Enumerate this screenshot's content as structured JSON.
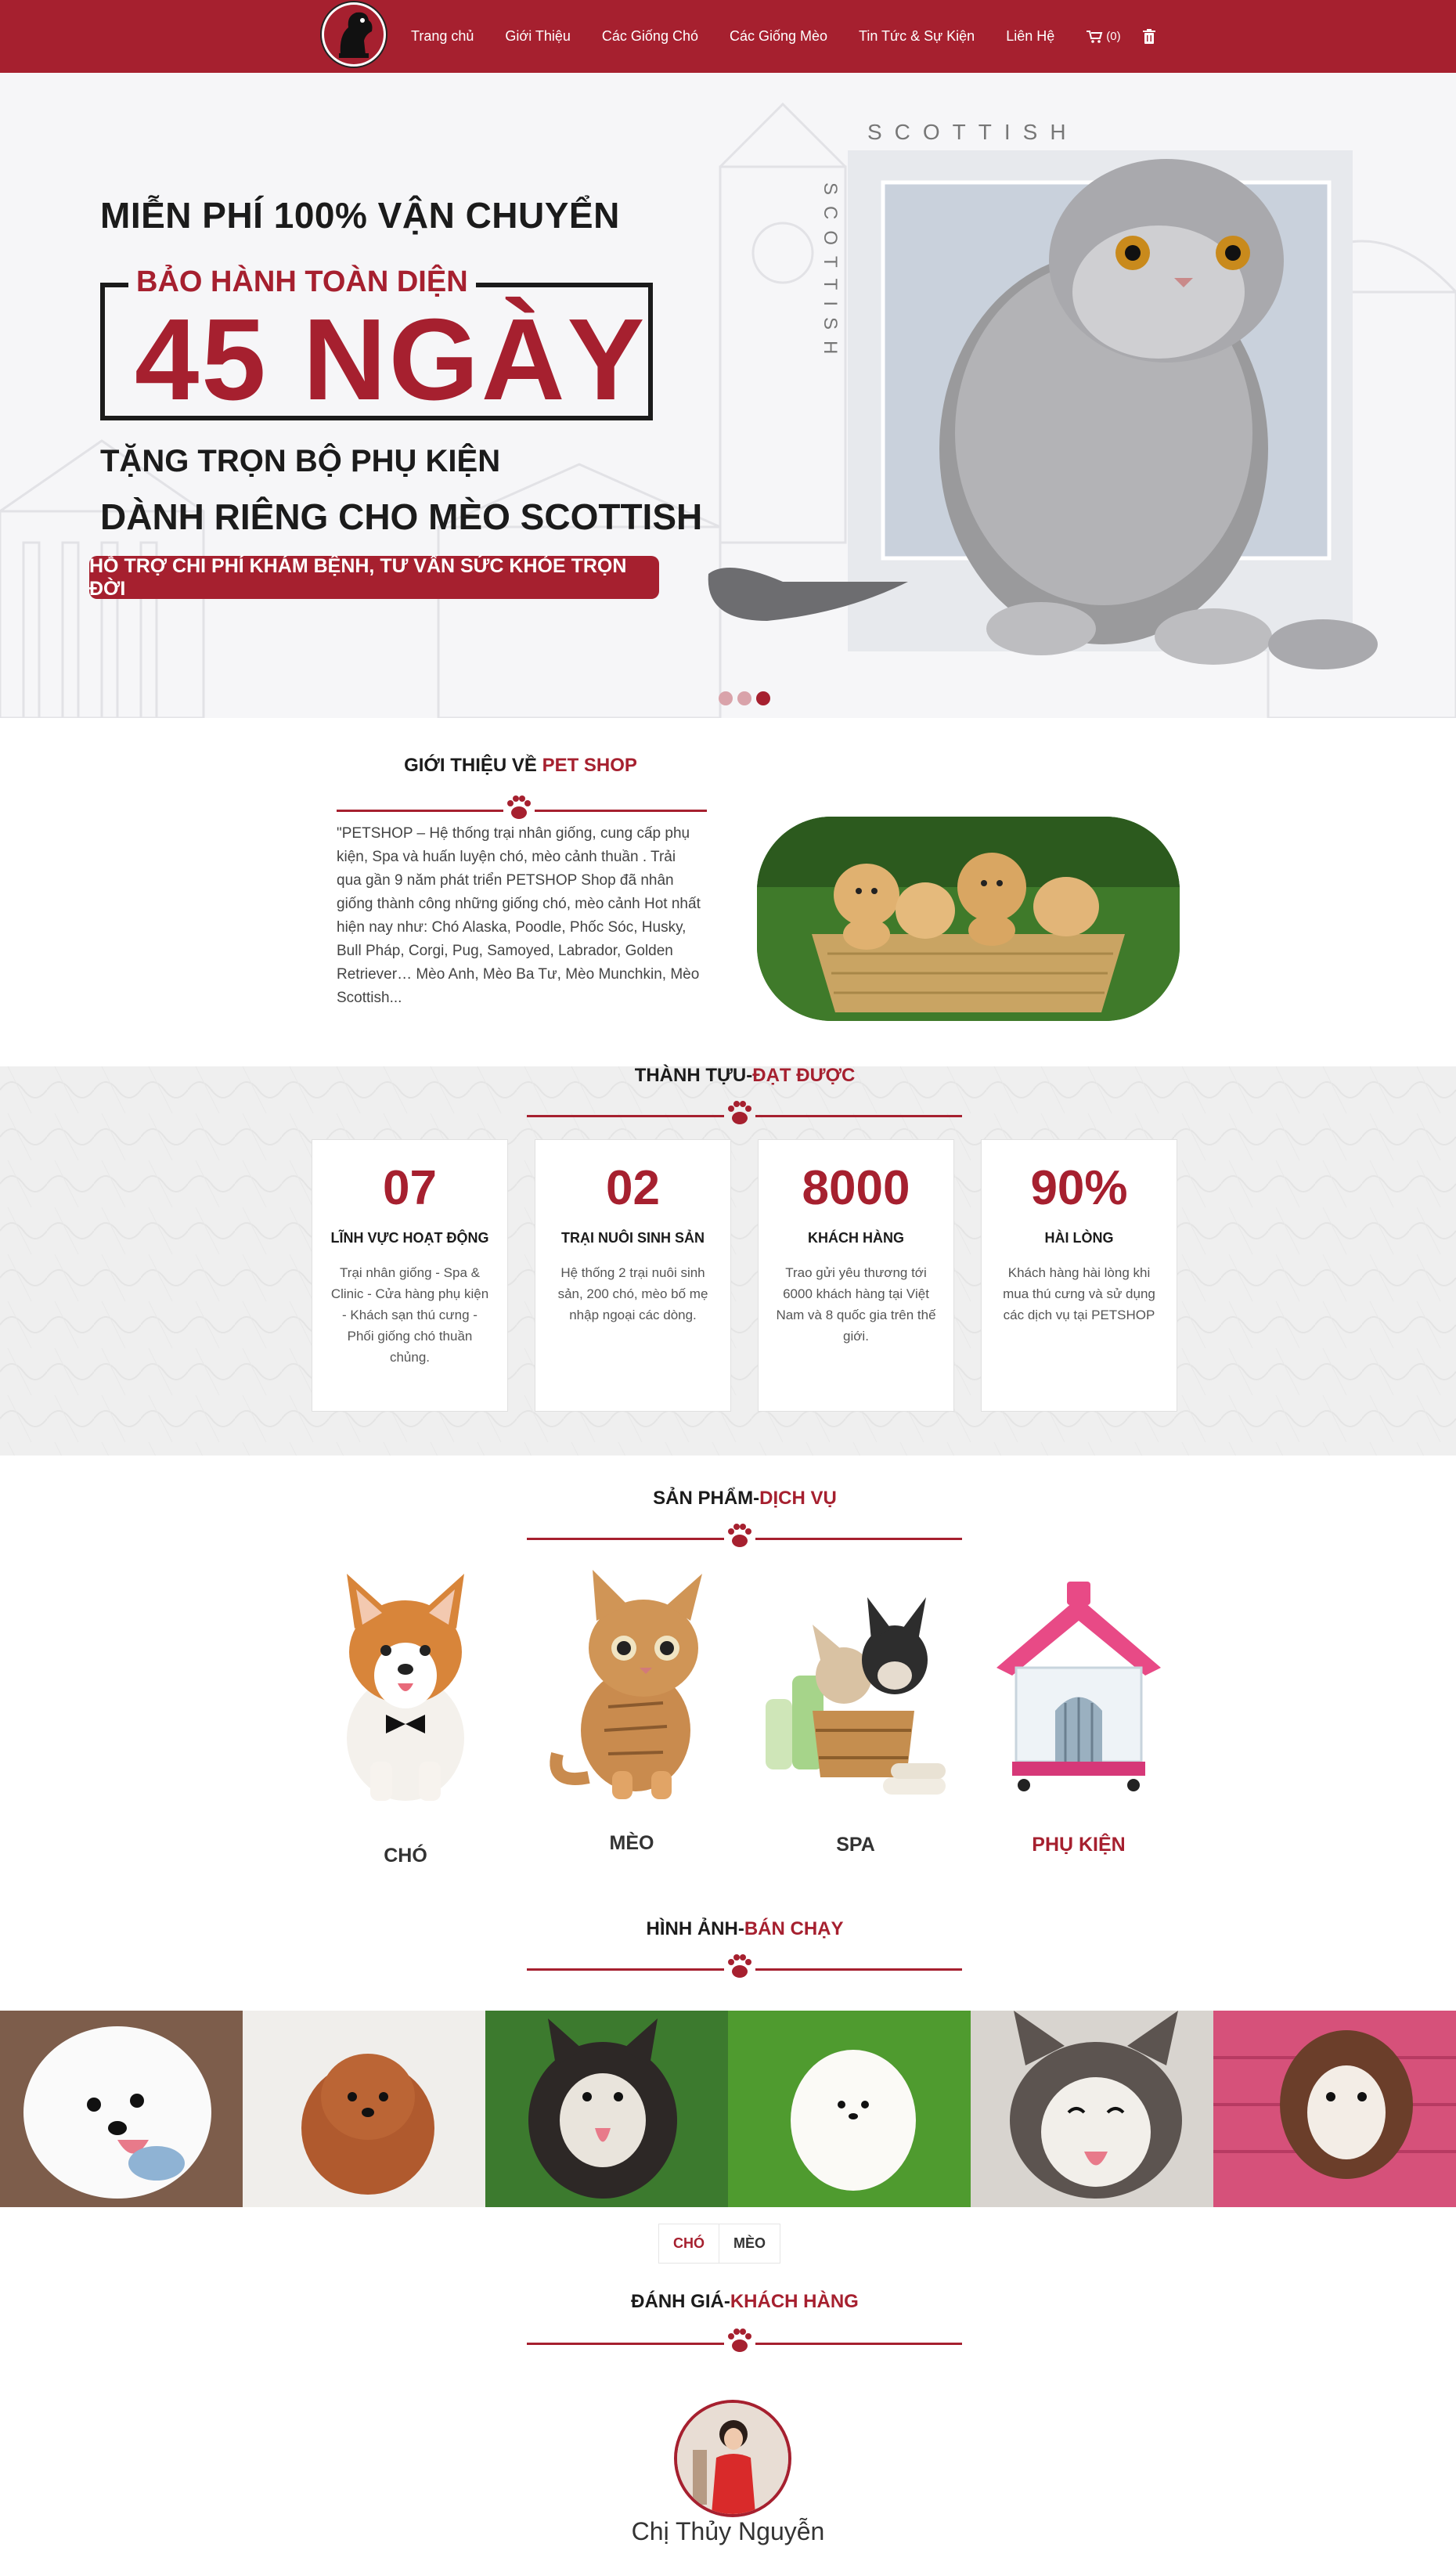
{
  "nav": {
    "items": [
      "Trang chủ",
      "Giới Thiệu",
      "Các Giống Chó",
      "Các Giống Mèo",
      "Tin Tức & Sự Kiện",
      "Liên Hệ"
    ],
    "cart_count": "(0)"
  },
  "hero": {
    "line1": "MIỄN PHÍ 100% VẬN CHUYỂN",
    "warranty_label": "BẢO HÀNH TOÀN DIỆN",
    "warranty_days": "45 NGÀY",
    "line3": "TẶNG TRỌN BỘ PHỤ KIỆN",
    "line4": "DÀNH RIÊNG CHO MÈO SCOTTISH",
    "pill": "HỖ TRỢ CHI PHÍ KHÁM BỆNH, TƯ VẤN SỨC KHỎE TRỌN ĐỜI",
    "brand_horizontal": "SCOTTISH",
    "brand_vertical": "SCOTTISH",
    "slide_count": 3,
    "active_slide": 3
  },
  "intro": {
    "title_prefix": "GIỚI THIỆU VỀ",
    "title_accent": "PET SHOP",
    "text": "\"PETSHOP – Hệ thống trại nhân giống, cung cấp phụ kiện, Spa và huấn luyện chó, mèo cảnh thuần . Trải qua gần 9 năm phát triển PETSHOP Shop đã nhân giống thành công những giống chó, mèo cảnh Hot nhất hiện nay như: Chó Alaska, Poodle, Phốc Sóc, Husky, Bull Pháp, Corgi, Pug, Samoyed, Labrador, Golden Retriever… Mèo Anh, Mèo Ba Tư, Mèo Munchkin, Mèo Scottish..."
  },
  "stats": {
    "title_prefix": "THÀNH TỰU-",
    "title_accent": "ĐẠT ĐƯỢC",
    "items": [
      {
        "number": "07",
        "label": "LĨNH VỰC HOẠT ĐỘNG",
        "desc": "Trại nhân giống - Spa & Clinic - Cửa hàng phụ kiện - Khách sạn thú cưng - Phối giống chó thuần chủng."
      },
      {
        "number": "02",
        "label": "TRẠI NUÔI SINH SẢN",
        "desc": "Hệ thống 2 trại nuôi sinh sản, 200 chó, mèo bố mẹ nhập ngoại các dòng."
      },
      {
        "number": "8000",
        "label": "KHÁCH HÀNG",
        "desc": "Trao gửi yêu thương tới 6000 khách hàng tại Việt Nam và 8 quốc gia trên thế giới."
      },
      {
        "number": "90%",
        "label": "HÀI LÒNG",
        "desc": "Khách hàng hài lòng khi mua thú cưng và sử dụng các dịch vụ tại PETSHOP"
      }
    ]
  },
  "products": {
    "title_prefix": "SẢN PHẨM-",
    "title_accent": "DỊCH VỤ",
    "items": [
      {
        "name": "CHÓ"
      },
      {
        "name": "MÈO"
      },
      {
        "name": "SPA"
      },
      {
        "name": "PHỤ KIỆN"
      }
    ]
  },
  "gallery": {
    "title_prefix": "HÌNH ẢNH-",
    "title_accent": "BÁN CHẠY",
    "tabs": [
      "CHÓ",
      "MÈO"
    ],
    "active_tab": "CHÓ"
  },
  "reviews": {
    "title_prefix": "ĐÁNH GIÁ-",
    "title_accent": "KHÁCH HÀNG",
    "reviewer": "Chị Thủy Nguyễn"
  },
  "colors": {
    "accent": "#a6202f"
  }
}
